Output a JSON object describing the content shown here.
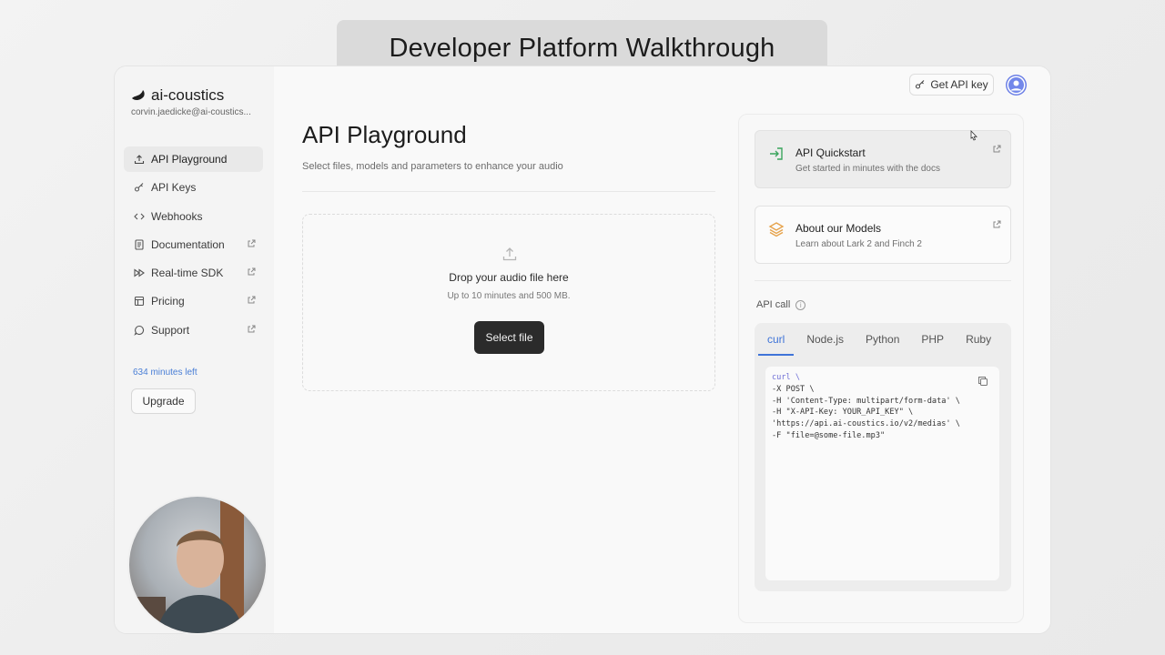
{
  "banner": {
    "title": "Developer Platform Walkthrough"
  },
  "sidebar": {
    "brand": "ai-coustics",
    "account": "corvin.jaedicke@ai-coustics...",
    "items": [
      {
        "label": "API Playground",
        "icon": "upload-icon",
        "active": true,
        "external": false
      },
      {
        "label": "API Keys",
        "icon": "key-icon",
        "active": false,
        "external": false
      },
      {
        "label": "Webhooks",
        "icon": "code-icon",
        "active": false,
        "external": false
      },
      {
        "label": "Documentation",
        "icon": "document-icon",
        "active": false,
        "external": true
      },
      {
        "label": "Real-time SDK",
        "icon": "fast-forward-icon",
        "active": false,
        "external": true
      },
      {
        "label": "Pricing",
        "icon": "pricing-icon",
        "active": false,
        "external": true
      },
      {
        "label": "Support",
        "icon": "chat-icon",
        "active": false,
        "external": true
      }
    ],
    "minutes_left": "634 minutes left",
    "upgrade_label": "Upgrade"
  },
  "header": {
    "get_api_key_label": "Get API key"
  },
  "main": {
    "title": "API Playground",
    "subtitle": "Select files, models and parameters to enhance your audio",
    "dropzone": {
      "title": "Drop your audio file here",
      "subtitle": "Up to 10 minutes and 500 MB.",
      "button_label": "Select file"
    }
  },
  "right_panel": {
    "cards": [
      {
        "title": "API Quickstart",
        "subtitle": "Get started in minutes with the docs",
        "icon": "sign-in-icon"
      },
      {
        "title": "About our Models",
        "subtitle": "Learn about Lark 2 and Finch 2",
        "icon": "layers-icon"
      }
    ],
    "api_call_label": "API call",
    "tabs": [
      "curl",
      "Node.js",
      "Python",
      "PHP",
      "Ruby"
    ],
    "active_tab": "curl",
    "code_lines": [
      "curl \\",
      "-X POST \\",
      "-H 'Content-Type: multipart/form-data' \\",
      "-H \"X-API-Key: YOUR_API_KEY\" \\",
      "'https://api.ai-coustics.io/v2/medias' \\",
      "-F \"file=@some-file.mp3\""
    ]
  },
  "colors": {
    "accent_blue": "#3f74d8",
    "minutes_blue": "#4a7fd6",
    "quickstart_green": "#3aa55d",
    "models_orange": "#e6a24a",
    "primary_button": "#2b2b2b"
  }
}
